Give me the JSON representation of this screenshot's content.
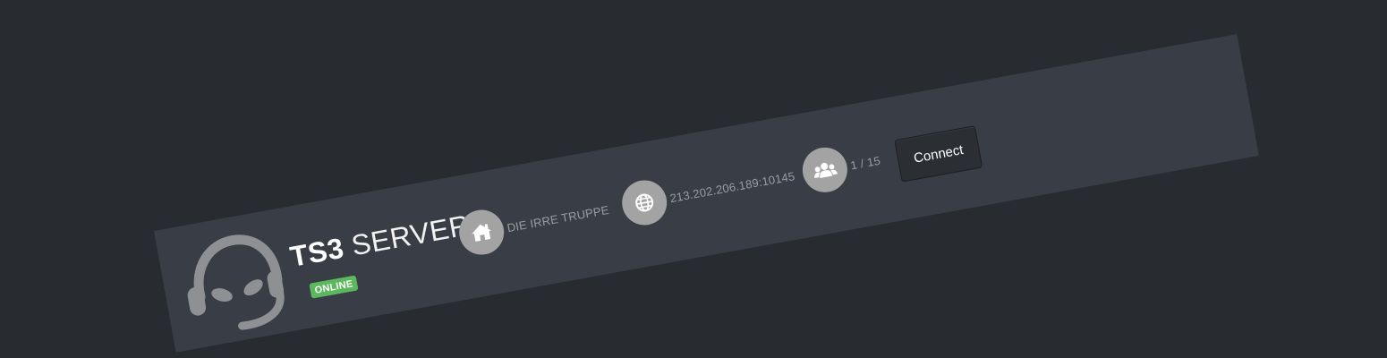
{
  "server": {
    "title_bold": "TS3",
    "title_light": "SERVER",
    "status": "ONLINE"
  },
  "info": {
    "name": "DIE IRRE TRUPPE",
    "address": "213.202.206.189:10145",
    "users": "1 / 15"
  },
  "actions": {
    "connect_label": "Connect"
  },
  "icons": {
    "logo": "teamspeak-headset-icon",
    "name": "home-icon",
    "address": "globe-icon",
    "users": "users-icon"
  },
  "colors": {
    "background": "#282b30",
    "banner": "#393d45",
    "online": "#5cb85c",
    "icon_circle": "#a3a3a3"
  }
}
